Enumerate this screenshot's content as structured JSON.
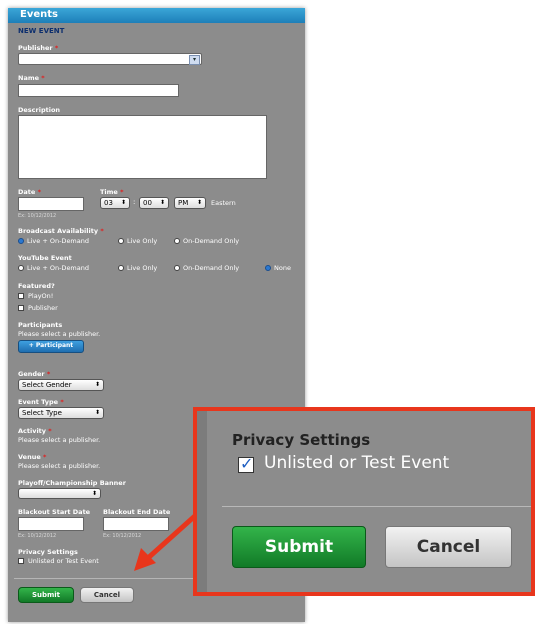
{
  "panel": {
    "title": "Events",
    "subtitle": "NEW EVENT"
  },
  "form": {
    "publisher_label": "Publisher",
    "name_label": "Name",
    "description_label": "Description",
    "date_label": "Date",
    "date_hint": "Ex: 10/12/2012",
    "time_label": "Time",
    "time_hour": "03",
    "time_minute": "00",
    "time_ampm": "PM",
    "timezone": "Eastern",
    "broadcast_label": "Broadcast Availability",
    "broadcast_options": [
      "Live + On-Demand",
      "Live Only",
      "On-Demand Only"
    ],
    "youtube_label": "YouTube Event",
    "youtube_options": [
      "Live + On-Demand",
      "Live Only",
      "On-Demand Only",
      "None"
    ],
    "featured_label": "Featured?",
    "featured_options": [
      "PlayOn!",
      "Publisher"
    ],
    "participants_label": "Participants",
    "participants_text": "Please select a publisher.",
    "participant_button": "+ Participant",
    "gender_label": "Gender",
    "gender_value": "Select Gender",
    "event_type_label": "Event Type",
    "event_type_value": "Select Type",
    "activity_label": "Activity",
    "activity_text": "Please select a publisher.",
    "venue_label": "Venue",
    "venue_text": "Please select a publisher.",
    "playoff_label": "Playoff/Championship Banner",
    "blackout_start_label": "Blackout Start Date",
    "blackout_end_label": "Blackout End Date",
    "blackout_hint": "Ex: 10/12/2012",
    "privacy_label": "Privacy Settings",
    "privacy_option": "Unlisted or Test Event",
    "submit": "Submit",
    "cancel": "Cancel"
  },
  "zoom": {
    "privacy_label": "Privacy Settings",
    "privacy_option": "Unlisted or Test Event",
    "privacy_checked": true,
    "submit": "Submit",
    "cancel": "Cancel"
  },
  "colors": {
    "callout": "#e8361c",
    "submit": "#1b8c35",
    "titlebar": "#1e7fb8"
  }
}
